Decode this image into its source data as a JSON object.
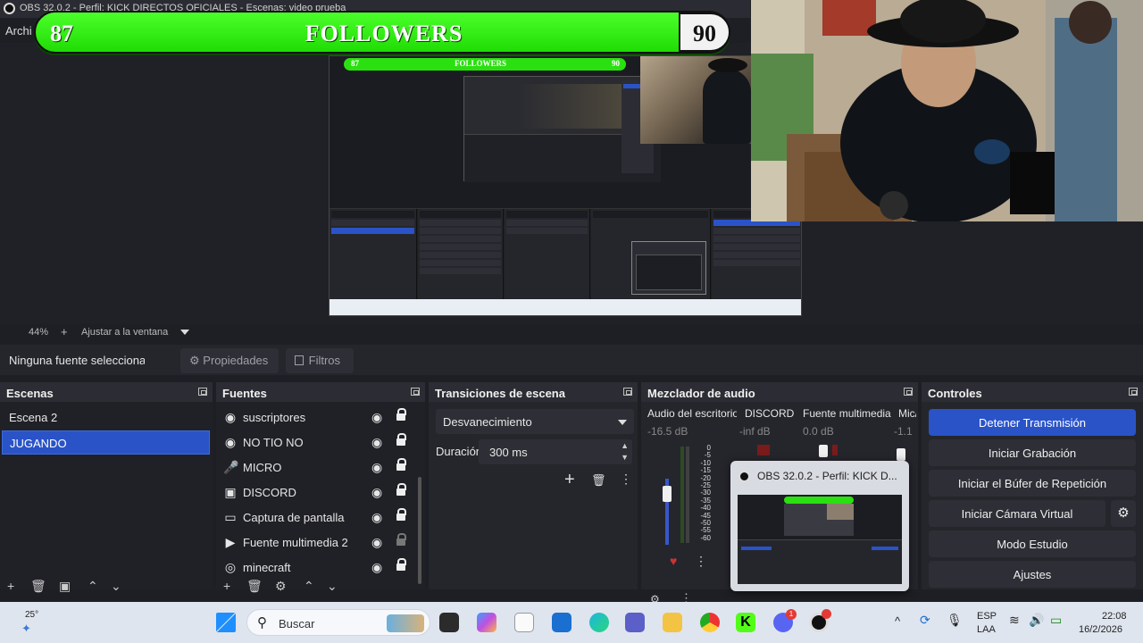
{
  "window": {
    "title": "OBS 32.0.2 - Perfil: KICK DIRECTOS OFICIALES - Escenas: video prueba",
    "menu_first": "Archi"
  },
  "banner": {
    "left_count": "87",
    "title": "FOLLOWERS",
    "right_count": "90"
  },
  "preview": {
    "zoom": "44%",
    "fit_label": "Ajustar a la ventana",
    "mini_left": "87",
    "mini_title": "FOLLOWERS",
    "mini_right": "90"
  },
  "source_toolbar": {
    "no_source": "Ninguna fuente seleccionada",
    "properties": "Propiedades",
    "filters": "Filtros"
  },
  "scenes": {
    "header": "Escenas",
    "items": [
      "Escena 2",
      "JUGANDO"
    ],
    "selected": "JUGANDO"
  },
  "sources": {
    "header": "Fuentes",
    "items": [
      {
        "name": "suscriptores",
        "icon": "browser-icon",
        "glyph": "◉",
        "locked": true
      },
      {
        "name": "NO TIO NO",
        "icon": "browser-icon",
        "glyph": "◉",
        "locked": true
      },
      {
        "name": "MICRO",
        "icon": "microphone-icon",
        "glyph": "🎤",
        "locked": true
      },
      {
        "name": "DISCORD",
        "icon": "window-capture-icon",
        "glyph": "▣",
        "locked": true
      },
      {
        "name": "Captura de pantalla",
        "icon": "monitor-icon",
        "glyph": "▭",
        "locked": true
      },
      {
        "name": "Fuente multimedia 2",
        "icon": "play-icon",
        "glyph": "▶",
        "locked": false
      },
      {
        "name": "minecraft",
        "icon": "gamepad-icon",
        "glyph": "◎",
        "locked": true
      }
    ]
  },
  "transitions": {
    "header": "Transiciones de escena",
    "selected": "Desvanecimiento",
    "duration_label": "Duración",
    "duration_value": "300 ms"
  },
  "mixer": {
    "header": "Mezclador de audio",
    "channels": [
      {
        "name": "Audio del escritorio",
        "db": "-16.5 dB"
      },
      {
        "name": "DISCORD",
        "db": "-inf dB"
      },
      {
        "name": "Fuente multimedia",
        "db": "0.0 dB"
      },
      {
        "name": "Mic/",
        "db": "-1.1"
      }
    ],
    "ticks": [
      "0",
      "-5",
      "-10",
      "-15",
      "-20",
      "-25",
      "-30",
      "-35",
      "-40",
      "-45",
      "-50",
      "-55",
      "-60"
    ]
  },
  "controls": {
    "header": "Controles",
    "buttons": [
      "Detener Transmisión",
      "Iniciar Grabación",
      "Iniciar el Búfer de Repetición",
      "Iniciar Cámara Virtual",
      "Modo Estudio",
      "Ajustes"
    ]
  },
  "popup": {
    "title": "OBS 32.0.2 - Perfil: KICK D..."
  },
  "taskbar": {
    "weather": "25°",
    "search_placeholder": "Buscar",
    "lang": "ESP",
    "lang_sub": "LAA",
    "time": "22:08",
    "date": "16/2/2026",
    "discord_badge": "1",
    "colors": {
      "accent": "#2a53c7",
      "banner_green": "#2be010"
    }
  }
}
